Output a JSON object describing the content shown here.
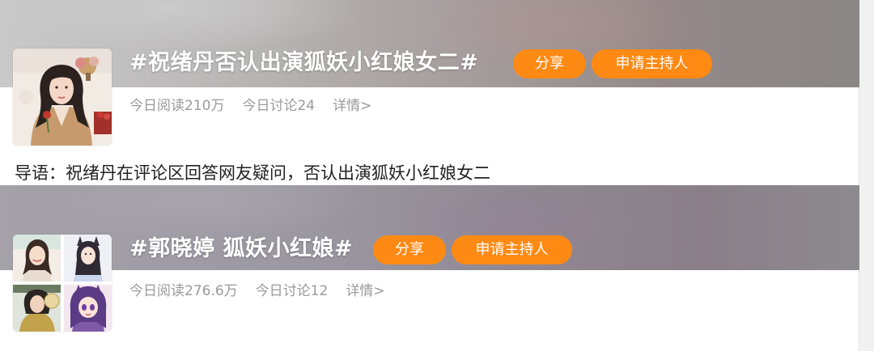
{
  "topics": [
    {
      "title": "#祝绪丹否认出演狐妖小红娘女二#",
      "share_label": "分享",
      "host_label": "申请主持人",
      "reads": "今日阅读210万",
      "discussions": "今日讨论24",
      "details": "详情>"
    },
    {
      "title": "#郭晓婷 狐妖小红娘#",
      "share_label": "分享",
      "host_label": "申请主持人",
      "reads": "今日阅读276.6万",
      "discussions": "今日讨论12",
      "details": "详情>"
    }
  ],
  "intro": "导语：祝绪丹在评论区回答网友疑问，否认出演狐妖小红娘女二",
  "colors": {
    "accent": "#ff8a13",
    "stats_text": "#9a9a9a"
  }
}
